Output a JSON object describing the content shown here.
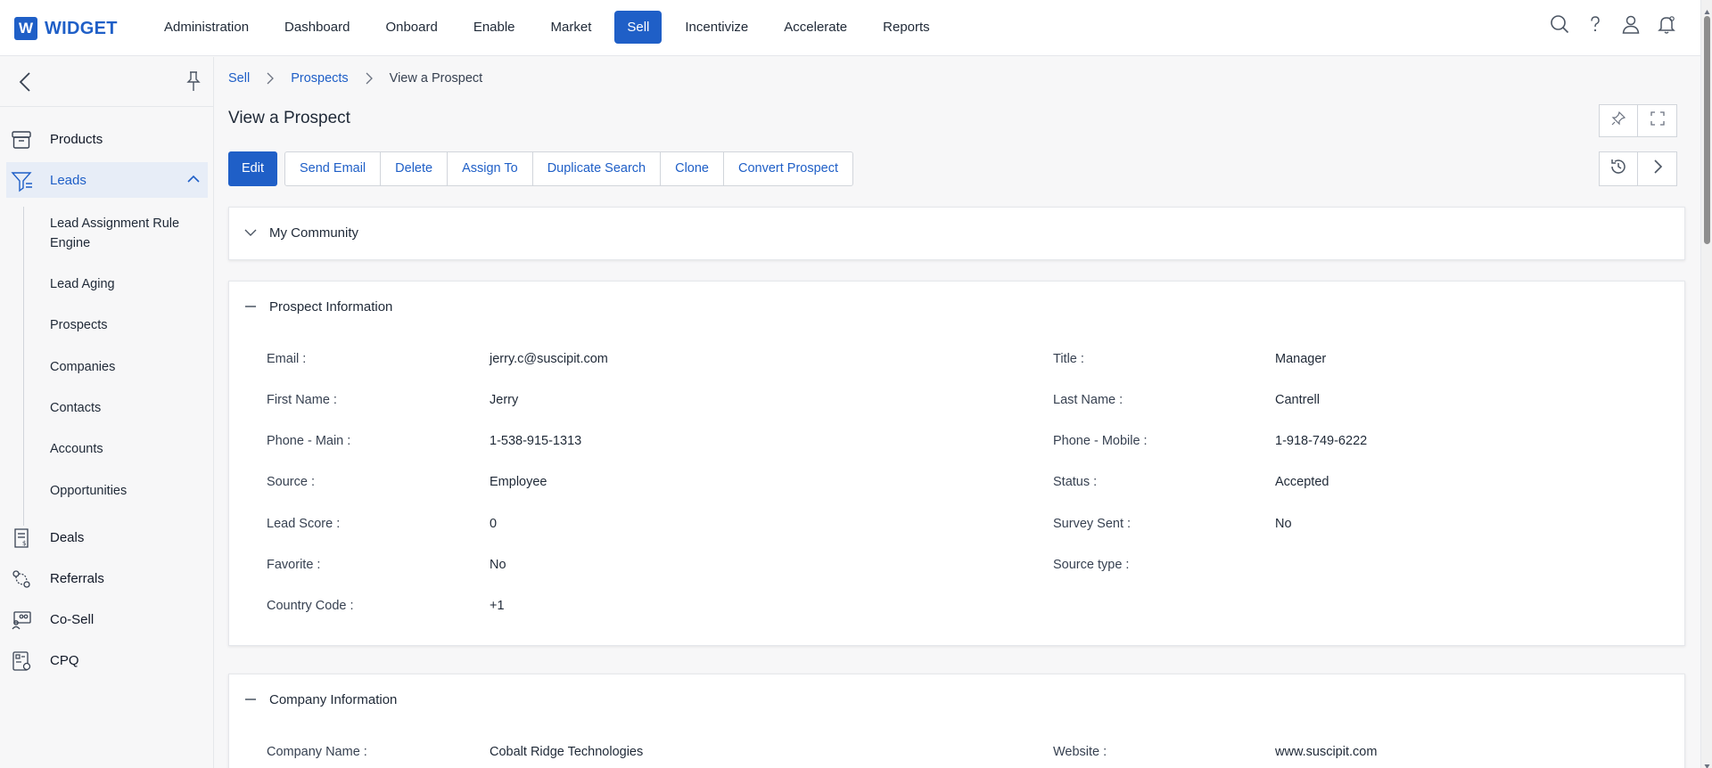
{
  "app": {
    "logo_letter": "W",
    "logo_name": "WIDGET",
    "brand_color": "#1f5fc7"
  },
  "topnav": {
    "items": [
      "Administration",
      "Dashboard",
      "Onboard",
      "Enable",
      "Market",
      "Sell",
      "Incentivize",
      "Accelerate",
      "Reports"
    ],
    "active": "Sell"
  },
  "top_icons": [
    "search-icon",
    "help-icon",
    "user-icon",
    "bell-icon"
  ],
  "sidebar": {
    "products": "Products",
    "leads": "Leads",
    "sub_items": [
      "Lead Assignment Rule Engine",
      "Lead Aging",
      "Prospects",
      "Companies",
      "Contacts",
      "Accounts",
      "Opportunities"
    ],
    "deals": "Deals",
    "referrals": "Referrals",
    "cosell": "Co-Sell",
    "cpq": "CPQ"
  },
  "breadcrumb": {
    "sell": "Sell",
    "prospects": "Prospects",
    "current": "View a Prospect"
  },
  "page_title": "View a Prospect",
  "toolbar": {
    "edit": "Edit",
    "send_email": "Send Email",
    "delete": "Delete",
    "assign_to": "Assign To",
    "duplicate_search": "Duplicate Search",
    "clone": "Clone",
    "convert_prospect": "Convert Prospect"
  },
  "sections": {
    "community": {
      "title": "My Community"
    },
    "prospect": {
      "title": "Prospect Information",
      "left": [
        {
          "label": "Email :",
          "value": "jerry.c@suscipit.com"
        },
        {
          "label": "First Name :",
          "value": "Jerry"
        },
        {
          "label": "Phone - Main :",
          "value": "1-538-915-1313"
        },
        {
          "label": "Source :",
          "value": "Employee"
        },
        {
          "label": "Lead Score :",
          "value": "0"
        },
        {
          "label": "Favorite :",
          "value": "No"
        },
        {
          "label": "Country Code :",
          "value": "+1"
        }
      ],
      "right": [
        {
          "label": "Title :",
          "value": "Manager"
        },
        {
          "label": "Last Name :",
          "value": "Cantrell"
        },
        {
          "label": "Phone - Mobile :",
          "value": "1-918-749-6222"
        },
        {
          "label": "Status :",
          "value": "Accepted"
        },
        {
          "label": "Survey Sent :",
          "value": "No"
        },
        {
          "label": "Source type :",
          "value": ""
        }
      ]
    },
    "company": {
      "title": "Company Information",
      "left": [
        {
          "label": "Company Name :",
          "value": "Cobalt Ridge Technologies"
        }
      ],
      "right": [
        {
          "label": "Website :",
          "value": "www.suscipit.com"
        }
      ]
    }
  }
}
